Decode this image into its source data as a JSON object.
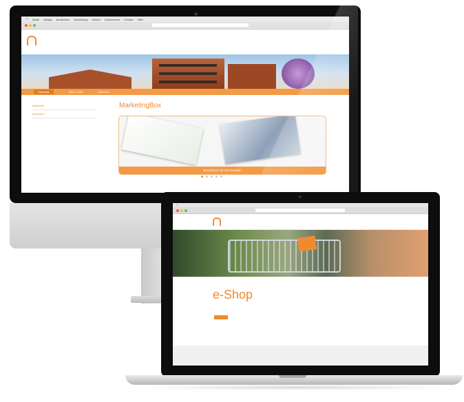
{
  "imac": {
    "menubar": {
      "items": [
        "Safari",
        "Ablage",
        "Bearbeiten",
        "Darstellung",
        "Verlauf",
        "Lesezeichen",
        "Fenster",
        "Hilfe"
      ]
    },
    "url": "",
    "site": {
      "logo_text": "",
      "top_links": [
        "",
        "",
        ""
      ],
      "nav": [
        "Startseite",
        "Mein Portal",
        "Netzwerk"
      ],
      "sidebar": [
        "Mitglieder",
        "Infoboxen"
      ],
      "main_title": "MarketingBox",
      "promo_banner": "Broschüren für Ihre Kunden",
      "pager_count": 5,
      "pager_active": 0
    }
  },
  "macbook": {
    "url": "",
    "site": {
      "logo_text": "",
      "nav": [
        "",
        "",
        "",
        "",
        ""
      ],
      "breadcrumb": "",
      "title": "e-Shop",
      "intro": "",
      "button_label": ""
    }
  },
  "colors": {
    "accent": "#f08a30",
    "nav": "#f29a45"
  }
}
